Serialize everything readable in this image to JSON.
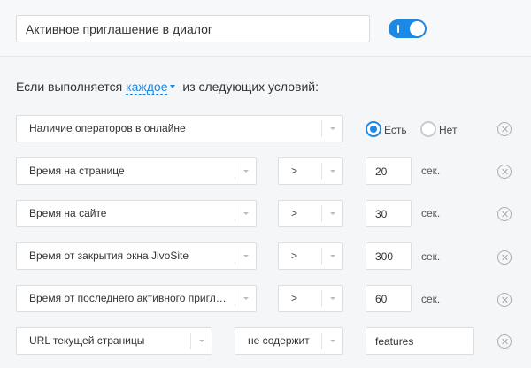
{
  "header": {
    "name_value": "Активное приглашение в диалог",
    "toggle_on": true
  },
  "conditions_heading": {
    "prefix": "Если выполняется",
    "mode": "каждое",
    "suffix": "из следующих условий:"
  },
  "rows": [
    {
      "field": "Наличие операторов в онлайне",
      "options": [
        "Есть",
        "Нет"
      ],
      "selected": "Есть"
    },
    {
      "field": "Время на странице",
      "operator": ">",
      "value": "20",
      "unit": "сек."
    },
    {
      "field": "Время на сайте",
      "operator": ">",
      "value": "30",
      "unit": "сек."
    },
    {
      "field": "Время от закрытия окна JivoSite",
      "operator": ">",
      "value": "300",
      "unit": "сек."
    },
    {
      "field": "Время от последнего активного приглашения",
      "operator": ">",
      "value": "60",
      "unit": "сек."
    },
    {
      "field": "URL текущей страницы",
      "operator": "не содержит",
      "value": "features"
    }
  ],
  "colors": {
    "accent": "#1e88e5",
    "border": "#dcdfe2",
    "background": "#f5f6f7"
  },
  "icons": {
    "remove": "close-circle-icon",
    "dropdown": "chevron-down-icon"
  }
}
